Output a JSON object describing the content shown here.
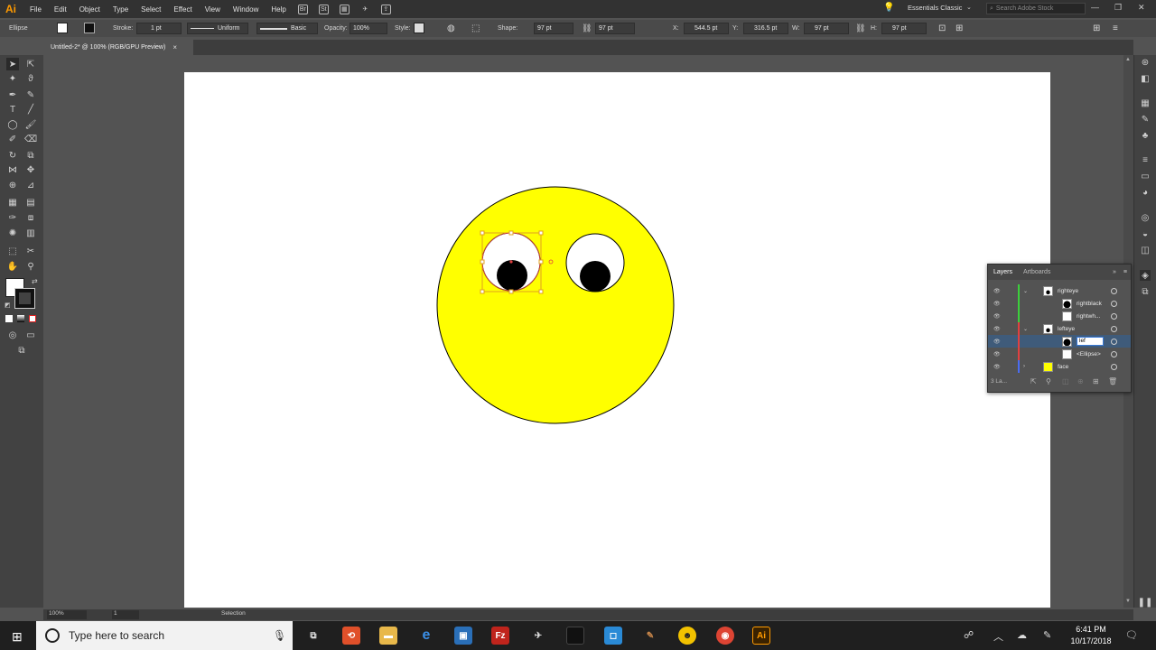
{
  "app": {
    "logo": "Ai"
  },
  "menu": [
    "File",
    "Edit",
    "Object",
    "Type",
    "Select",
    "Effect",
    "View",
    "Window",
    "Help"
  ],
  "menu_icons": [
    "Br",
    "St"
  ],
  "workspace": "Essentials Classic",
  "stock_search_placeholder": "Search Adobe Stock",
  "control": {
    "selection_label": "Ellipse",
    "stroke_label": "Stroke:",
    "stroke_weight": "1 pt",
    "stroke_profile": "Uniform",
    "brush": "Basic",
    "opacity_label": "Opacity:",
    "opacity": "100%",
    "style_label": "Style:",
    "shape_label": "Shape:",
    "shape_w": "97 pt",
    "shape_h": "97 pt",
    "x_label": "X:",
    "x": "544.5 pt",
    "y_label": "Y:",
    "y": "316.5 pt",
    "w_label": "W:",
    "w": "97 pt",
    "h_label": "H:",
    "h": "97 pt"
  },
  "document_tab": {
    "title": "Untitled-2* @ 100% (RGB/GPU Preview)",
    "close": "×"
  },
  "layers_panel": {
    "tabs": [
      "Layers",
      "Artboards"
    ],
    "rows": [
      {
        "name": "righteye",
        "color": "#3ccf3c",
        "indent": 0,
        "expanded": true,
        "thumb": "group"
      },
      {
        "name": "rightblack",
        "color": "#3ccf3c",
        "indent": 1,
        "thumb": "black"
      },
      {
        "name": "rightwh...",
        "color": "#3ccf3c",
        "indent": 1,
        "thumb": "white"
      },
      {
        "name": "lefteye",
        "color": "#e04040",
        "indent": 0,
        "expanded": true,
        "thumb": "group"
      },
      {
        "name": "lef",
        "color": "#e04040",
        "indent": 1,
        "thumb": "black",
        "selected": true,
        "editing": true
      },
      {
        "name": "<Ellipse>",
        "color": "#e04040",
        "indent": 1,
        "thumb": "white"
      },
      {
        "name": "face",
        "color": "#4a6cf0",
        "indent": 0,
        "expanded": false,
        "thumb": "yellow"
      }
    ],
    "footer_count": "3 La..."
  },
  "status": {
    "zoom": "100%",
    "page": "1",
    "tool": "Selection"
  },
  "taskbar": {
    "search_placeholder": "Type here to search",
    "time": "6:41 PM",
    "date": "10/17/2018"
  },
  "colors": {
    "face": "#ffff00",
    "selection_bbox": "#e0a020",
    "accent": "#ff9a00"
  }
}
